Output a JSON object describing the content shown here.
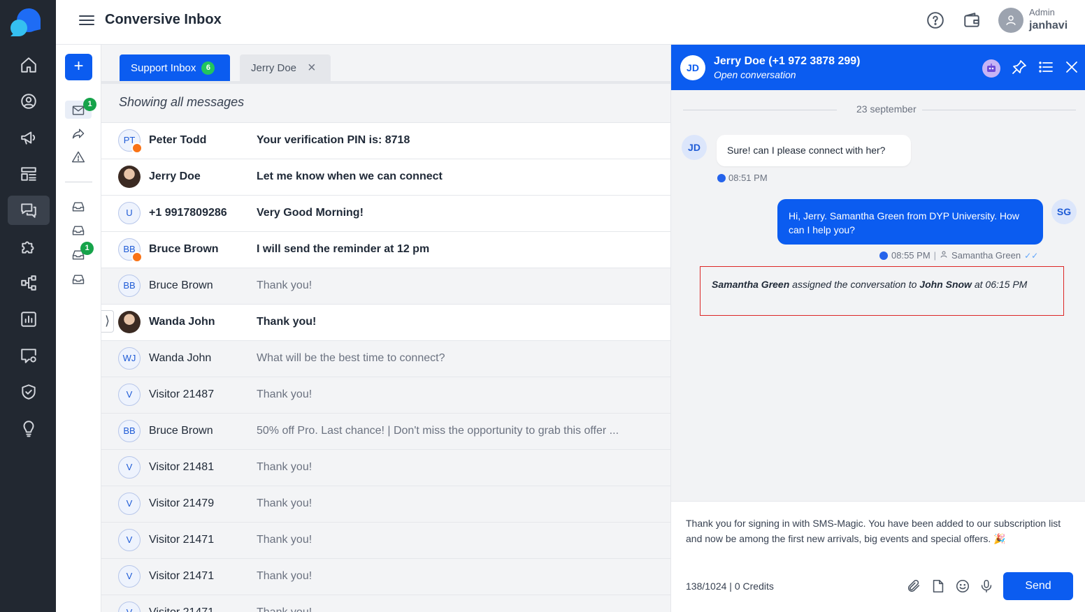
{
  "header": {
    "title": "Conversive Inbox",
    "user_role": "Admin",
    "user_name": "janhavi"
  },
  "rail": {
    "compose_label": "+",
    "inbox_badge": "1",
    "sub_badge": "1"
  },
  "tabs": [
    {
      "label": "Support Inbox",
      "count": "6"
    },
    {
      "label": "Jerry Doe",
      "close": "×"
    }
  ],
  "list": {
    "heading": "Showing all messages",
    "rows": [
      {
        "initials": "PT",
        "name": "Peter Todd",
        "message": "Your verification PIN is: 8718",
        "unread": true
      },
      {
        "initials": "",
        "name": "Jerry Doe",
        "message": "Let me know when we can connect",
        "unread": true
      },
      {
        "initials": "U",
        "name": "+1 9917809286",
        "message": "Very Good Morning!",
        "unread": true
      },
      {
        "initials": "BB",
        "name": "Bruce Brown",
        "message": "I will send the reminder at 12 pm",
        "unread": true
      },
      {
        "initials": "BB",
        "name": "Bruce Brown",
        "message": "Thank you!",
        "unread": false
      },
      {
        "initials": "",
        "name": "Wanda John",
        "message": "Thank you!",
        "unread": true
      },
      {
        "initials": "WJ",
        "name": "Wanda John",
        "message": "What will be the best time to connect?",
        "unread": false
      },
      {
        "initials": "V",
        "name": "Visitor 21487",
        "message": "Thank you!",
        "unread": false
      },
      {
        "initials": "BB",
        "name": "Bruce Brown",
        "message": "50% off Pro. Last chance! | Don't miss the opportunity to grab this offer ...",
        "unread": false
      },
      {
        "initials": "V",
        "name": "Visitor 21481",
        "message": "Thank you!",
        "unread": false
      },
      {
        "initials": "V",
        "name": "Visitor 21479",
        "message": "Thank you!",
        "unread": false
      },
      {
        "initials": "V",
        "name": "Visitor 21471",
        "message": "Thank you!",
        "unread": false
      },
      {
        "initials": "V",
        "name": "Visitor 21471",
        "message": "Thank you!",
        "unread": false
      },
      {
        "initials": "V",
        "name": "Visitor 21471",
        "message": "Thank you!",
        "unread": false
      }
    ]
  },
  "conversation": {
    "avatar": "JD",
    "title": "Jerry Doe (+1 972 3878 299)",
    "subtitle": "Open conversation",
    "date_separator": "23 september",
    "incoming": {
      "avatar": "JD",
      "text": "Sure! can I please connect with her?",
      "time": "08:51 PM"
    },
    "outgoing": {
      "avatar": "SG",
      "text": "Hi, Jerry. Samantha Green from DYP University. How can I help you?",
      "time": "08:55 PM",
      "sender": "Samantha Green"
    },
    "event": {
      "actor": "Samantha Green",
      "action": " assigned the conversation to ",
      "target": "John Snow",
      "at": " at ",
      "time": "06:15 PM"
    },
    "composer": {
      "text": "Thank you for signing in with SMS-Magic. You have been added to our subscription list and now be among the first new arrivals, big events and special offers. 🎉",
      "counter": "138/1024",
      "credits": "0 Credits",
      "send_label": "Send"
    }
  },
  "colors": {
    "primary": "#0b5cf0",
    "nav_bg": "#222831",
    "badge_green": "#22c55e",
    "event_border": "#dc2626"
  }
}
